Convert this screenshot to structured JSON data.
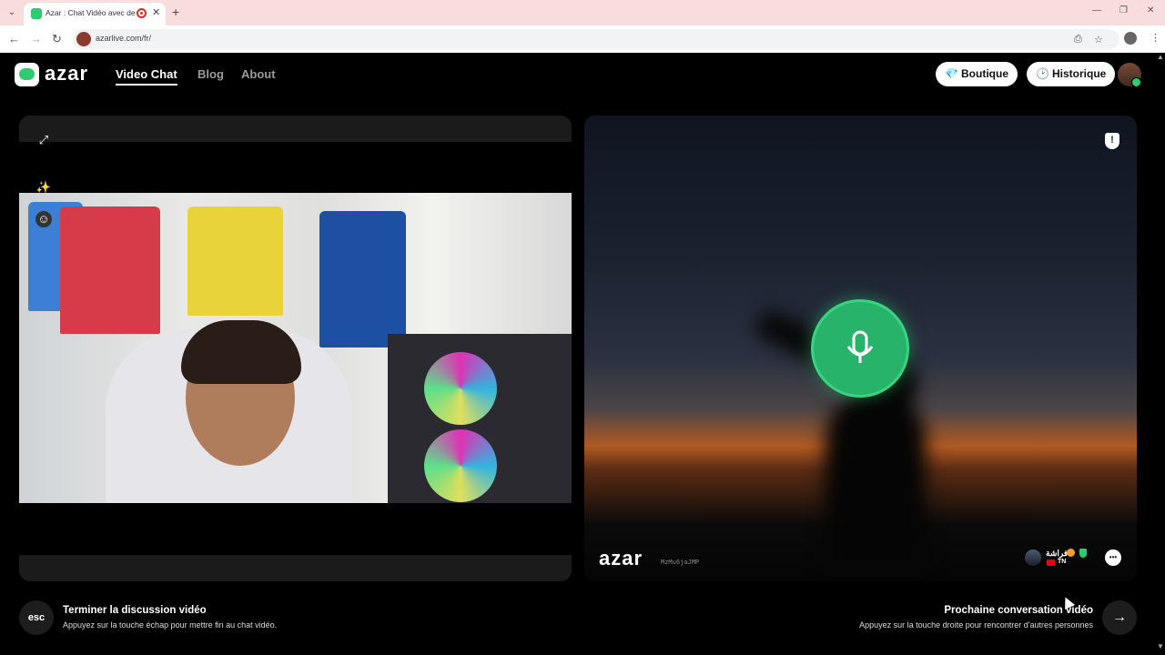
{
  "browser": {
    "tab_title": "Azar : Chat Vidéo avec de n",
    "new_tab_glyph": "+",
    "tab_close_glyph": "✕",
    "url": "azarlive.com/fr/"
  },
  "header": {
    "logo_text": "azar",
    "nav": [
      "Video Chat",
      "Blog",
      "About"
    ],
    "shop_label": "Boutique",
    "history_label": "Historique"
  },
  "remote": {
    "logo_text": "azar",
    "peer_id": "MzMu6jaJMP",
    "peer_name": "فراشة",
    "peer_country": "TN",
    "chat_glyph": "•••"
  },
  "footer": {
    "esc_label": "esc",
    "end_title": "Terminer la discussion vidéo",
    "end_sub": "Appuyez sur la touche échap pour mettre fin au chat vidéo.",
    "next_title": "Prochaine conversation vidéo",
    "next_sub": "Appuyez sur la touche droite pour rencontrer d'autres personnes",
    "next_glyph": "→"
  },
  "icons": [
    "tab-list-icon",
    "recording-icon",
    "back-icon",
    "forward-icon",
    "reload-icon",
    "install-icon",
    "bookmark-star-icon",
    "extensions-icon",
    "menu-icon",
    "fullscreen-icon",
    "magic-wand-icon",
    "face-filter-icon",
    "diamond-icon",
    "clock-icon",
    "microphone-icon",
    "report-shield-icon",
    "chat-icon",
    "arrow-right-icon"
  ],
  "colors": {
    "accent": "#2ecc71",
    "mic": "#27b36a",
    "background": "#000000",
    "tabbar": "#f9dcdc"
  }
}
